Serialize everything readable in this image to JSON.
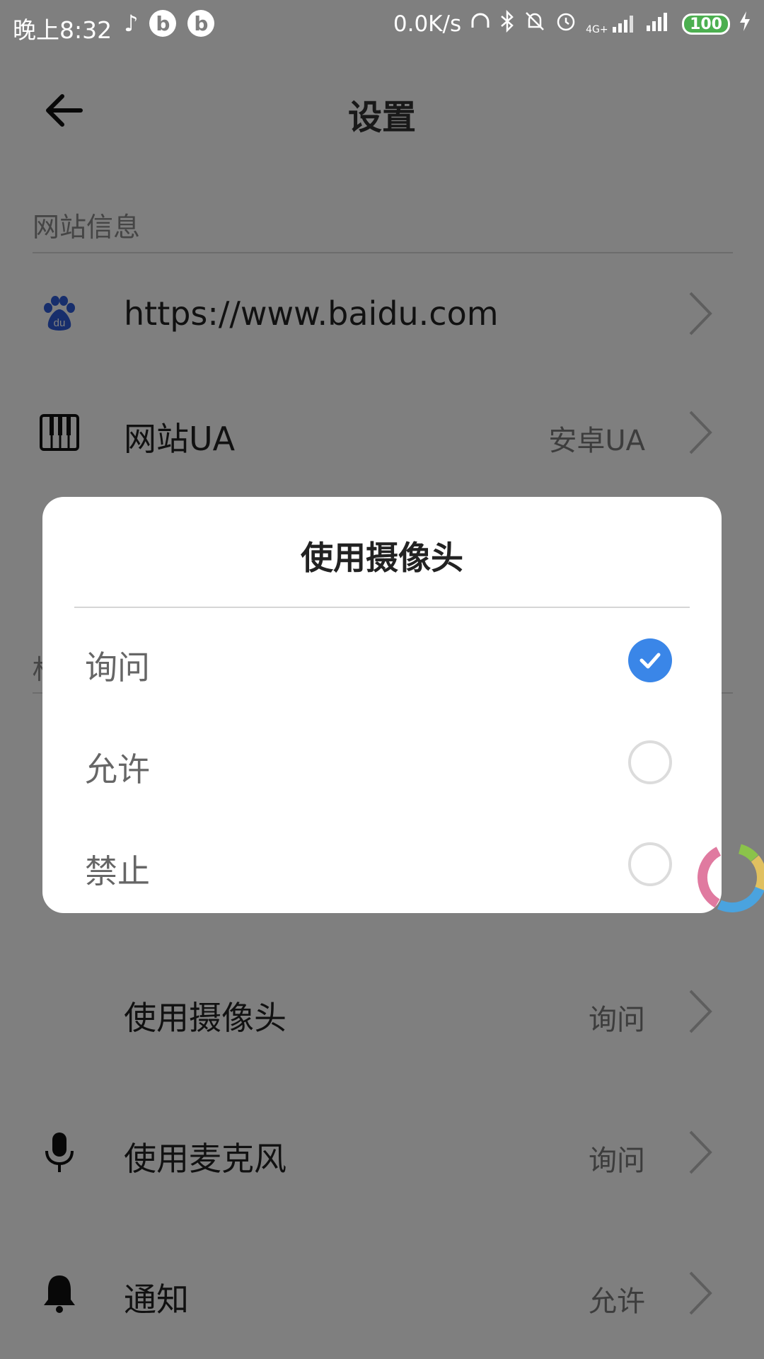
{
  "status_bar": {
    "time": "晚上8:32",
    "network_speed": "0.0K/s",
    "signal_label": "4G+",
    "battery": "100"
  },
  "header": {
    "title": "设置"
  },
  "sections": {
    "site_info_title": "网站信息",
    "second_section_partial": "权"
  },
  "rows": {
    "url": {
      "label": "https://www.baidu.com"
    },
    "ua": {
      "label": "网站UA",
      "value": "安卓UA"
    },
    "camera": {
      "label": "使用摄像头",
      "value": "询问"
    },
    "microphone": {
      "label": "使用麦克风",
      "value": "询问"
    },
    "notification": {
      "label": "通知",
      "value": "允许"
    }
  },
  "dialog": {
    "title": "使用摄像头",
    "options": [
      {
        "label": "询问",
        "selected": true
      },
      {
        "label": "允许",
        "selected": false
      },
      {
        "label": "禁止",
        "selected": false
      }
    ]
  },
  "colors": {
    "accent": "#3a86e8",
    "overlay": "rgba(0,0,0,0.5)"
  }
}
